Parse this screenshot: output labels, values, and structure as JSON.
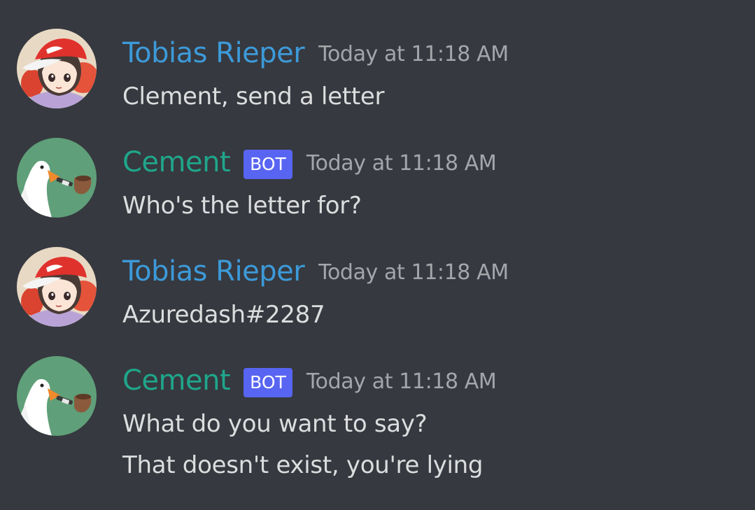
{
  "messages": [
    {
      "author": "Tobias Rieper",
      "is_bot": false,
      "avatar": "trainer-red-cap-avatar",
      "timestamp": "Today at 11:18 AM",
      "lines": [
        "Clement, send a letter"
      ]
    },
    {
      "author": "Cement",
      "is_bot": true,
      "bot_tag": "BOT",
      "avatar": "goose-with-pipe-avatar",
      "timestamp": "Today at 11:18 AM",
      "lines": [
        "Who's the letter for?"
      ]
    },
    {
      "author": "Tobias Rieper",
      "is_bot": false,
      "avatar": "trainer-red-cap-avatar",
      "timestamp": "Today at 11:18 AM",
      "lines": [
        "Azuredash#2287"
      ]
    },
    {
      "author": "Cement",
      "is_bot": true,
      "bot_tag": "BOT",
      "avatar": "goose-with-pipe-avatar",
      "timestamp": "Today at 11:18 AM",
      "lines": [
        "What do you want to say?",
        "That doesn't exist, you're lying"
      ]
    }
  ],
  "colors": {
    "background": "#36393f",
    "user_name": "#3d9ad9",
    "bot_name": "#1fa68b",
    "bot_tag": "#5865f2",
    "timestamp": "#a3a6aa",
    "message_text": "#dcddde"
  }
}
